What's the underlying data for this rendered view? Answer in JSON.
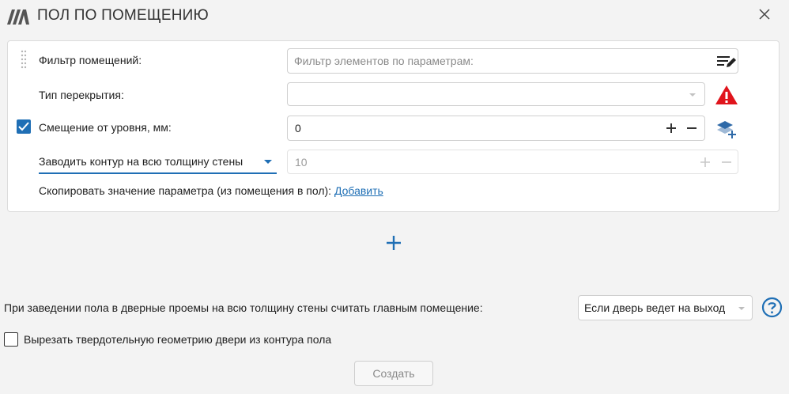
{
  "window": {
    "title": "ПОЛ ПО ПОМЕЩЕНИЮ"
  },
  "rule": {
    "room_filter": {
      "label": "Фильтр помещений:",
      "placeholder": "Фильтр элементов по параметрам:"
    },
    "floor_type": {
      "label": "Тип перекрытия:",
      "value": ""
    },
    "level_offset": {
      "checked": true,
      "label": "Смещение от уровня, мм:",
      "value": "0"
    },
    "contour_mode": {
      "selected": "Заводить контур на всю толщину стены",
      "value": "10"
    },
    "copy_param": {
      "label": "Скопировать значение параметра (из помещения в пол):",
      "link": "Добавить"
    }
  },
  "add_rule_symbol": "+",
  "door_main_room": {
    "label": "При заведении пола в дверные проемы на всю толщину стены считать главным помещение:",
    "selected": "Если дверь ведет на выход"
  },
  "cut_door_geometry": {
    "checked": false,
    "label": "Вырезать твердотельную геометрию двери из контура пола"
  },
  "create_button": "Создать",
  "colors": {
    "accent": "#1f6fb5",
    "warning": "#e0141c",
    "background": "#f3f3f3"
  },
  "icons": [
    "app-logo-icon",
    "close-icon",
    "drag-handle-icon",
    "filter-edit-icon",
    "chevron-down-icon",
    "warning-icon",
    "plus-icon",
    "minus-icon",
    "layers-add-icon",
    "help-icon",
    "checkmark-icon"
  ]
}
